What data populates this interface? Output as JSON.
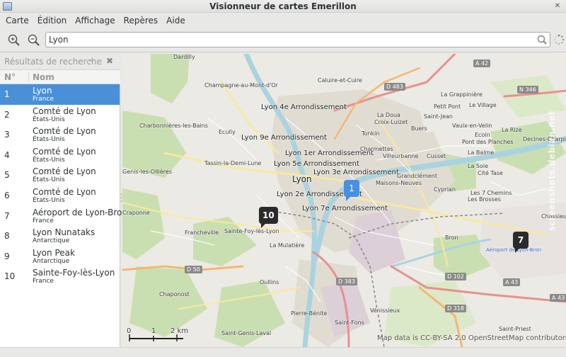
{
  "window": {
    "title": "Visionneur de cartes Emerillon"
  },
  "menu": [
    "Carte",
    "Édition",
    "Affichage",
    "Repères",
    "Aide"
  ],
  "toolbar": {
    "zoom_in_icon": "zoom-in-icon",
    "zoom_out_icon": "zoom-out-icon",
    "search_value": "Lyon"
  },
  "sidebar": {
    "combo_label": "Résultats de recherche",
    "col_no": "N°",
    "col_name": "Nom",
    "results": [
      {
        "no": "1",
        "name": "Lyon",
        "country": "France",
        "selected": true
      },
      {
        "no": "2",
        "name": "Comté de Lyon",
        "country": "États-Unis"
      },
      {
        "no": "3",
        "name": "Comté de Lyon",
        "country": "États-Unis"
      },
      {
        "no": "4",
        "name": "Comté de Lyon",
        "country": "États-Unis"
      },
      {
        "no": "5",
        "name": "Comté de Lyon",
        "country": "États-Unis"
      },
      {
        "no": "6",
        "name": "Comté de Lyon",
        "country": "États-Unis"
      },
      {
        "no": "7",
        "name": "Aéroport de Lyon-Bron",
        "country": "France"
      },
      {
        "no": "8",
        "name": "Lyon Nunataks",
        "country": "Antarctique"
      },
      {
        "no": "9",
        "name": "Lyon Peak",
        "country": "Antarctique"
      },
      {
        "no": "10",
        "name": "Sainte-Foy-lès-Lyon",
        "country": "France"
      }
    ]
  },
  "map": {
    "labels": {
      "dardilly": "Dardilly",
      "caluire": "Caluire-et-Cuire",
      "champagne": "Champagne-au-Mont-d'Or",
      "grappiniere": "La Grappinière",
      "petitpont": "Petit Pont",
      "levillage": "Le Village",
      "charbonnieres": "Charbonnières-les-Bains",
      "lyon4": "Lyon 4e Arrondissement",
      "ladoua": "La Doua",
      "croixluizet": "Croix-Luizet",
      "saintjean": "Saint-Jean",
      "vaulx": "Vaulx-en-Velin",
      "ecully": "Ecully",
      "lyon9": "Lyon 9e Arrondissement",
      "tonkin": "Tonkin",
      "buers": "Buers",
      "ecoin": "Ecoin",
      "larize": "La Rize",
      "decines": "Decines-Charpieu",
      "pontdesplanches": "Pont des Planches",
      "lyon1": "Lyon 1er Arrondissement",
      "charmettes": "Charmettes",
      "villeurbanne": "Villeurbanne",
      "cusset": "Cusset",
      "labalme": "La Balme",
      "tassin": "Tassin-la-Demi-Lune",
      "lyon5": "Lyon 5e Arrondissement",
      "lasoie": "La Soie",
      "citetase": "Cité Tase",
      "genis": "Genis-les-Ollières",
      "lyon": "Lyon",
      "lyon3": "Lyon 3e Arrondissement",
      "grandclement": "Grandclément",
      "maisonsneuves": "Maisons-Neuves",
      "lyon2": "Lyon 2e Arrondissement",
      "cyprian": "Cyprian",
      "chenes": "Les 7 Chemins",
      "brosses": "Les Brosses",
      "lyon7": "Lyon 7e Arrondissement",
      "craponne": "Craponne",
      "francheville": "Francheville",
      "saintefoy": "Sainte-Foy-lès-Lyon",
      "bron": "Bron",
      "mulatiere": "La Mulatière",
      "oullins": "Oullins",
      "chaponost": "Chaponost",
      "venissieux": "Vénissieux",
      "pierrebenite": "Pierre-Bénite",
      "saintfons": "Saint-Fons",
      "saintpriest": "Saint-Priest",
      "saintgenis": "Saint-Genis-Laval",
      "chassieu": "Chassieu",
      "aeroport": "Aéroport de Lyon-Bron"
    },
    "shields": {
      "a42": "A 42",
      "d483": "D 483",
      "n346": "N 346",
      "d50": "D 50",
      "d102": "D 102",
      "a43": "A 43",
      "d383": "D 383",
      "d318": "D 318",
      "a43b": "A 43"
    },
    "markers": [
      {
        "no": "1",
        "style": "blue"
      },
      {
        "no": "10",
        "style": "dark"
      },
      {
        "no": "7",
        "style": "dark"
      }
    ],
    "scale": {
      "t0": "0",
      "t1": "1",
      "t2": "2 km"
    },
    "attribution": "Map data is CC-BY-SA 2.0 OpenStreetMap contributors",
    "watermark": "screenshots.debian.net"
  }
}
